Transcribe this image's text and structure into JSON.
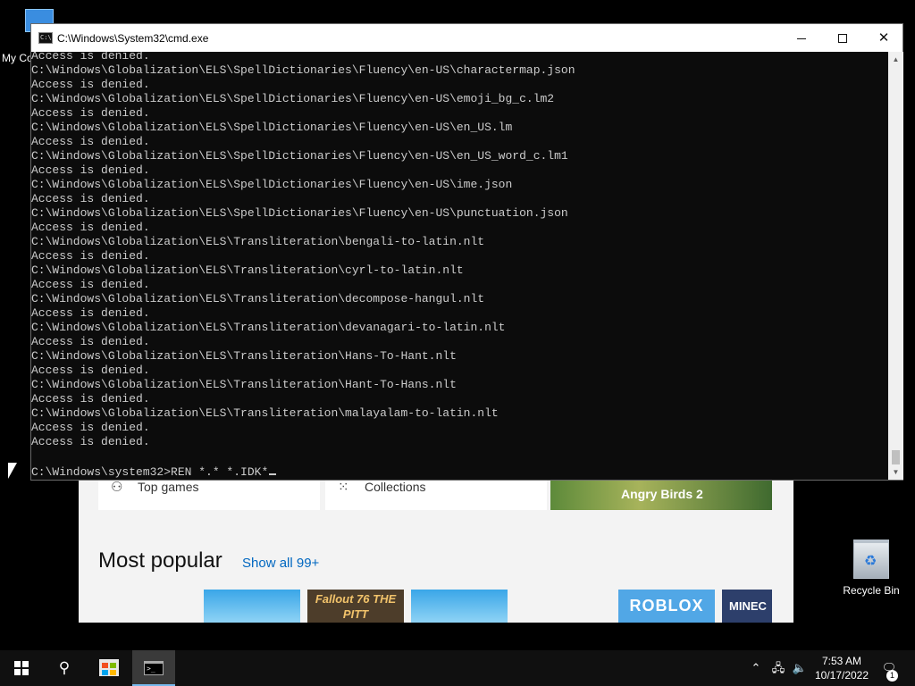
{
  "desktop": {
    "my_computer_label": "My Co",
    "recycle_bin_label": "Recycle Bin"
  },
  "store": {
    "cards": [
      "Top games",
      "Collections"
    ],
    "featured": "Angry Birds 2",
    "section_title": "Most popular",
    "show_all": "Show all 99+",
    "tiles": [
      "",
      "Fallout 76 THE PITT",
      "",
      "ROBLOX",
      "MINEC"
    ]
  },
  "cmd": {
    "title": "C:\\Windows\\System32\\cmd.exe",
    "icon_text": "C:\\",
    "lines": [
      "Access is denied.",
      "C:\\Windows\\Globalization\\ELS\\SpellDictionaries\\Fluency\\en-US\\charactermap.json",
      "Access is denied.",
      "C:\\Windows\\Globalization\\ELS\\SpellDictionaries\\Fluency\\en-US\\emoji_bg_c.lm2",
      "Access is denied.",
      "C:\\Windows\\Globalization\\ELS\\SpellDictionaries\\Fluency\\en-US\\en_US.lm",
      "Access is denied.",
      "C:\\Windows\\Globalization\\ELS\\SpellDictionaries\\Fluency\\en-US\\en_US_word_c.lm1",
      "Access is denied.",
      "C:\\Windows\\Globalization\\ELS\\SpellDictionaries\\Fluency\\en-US\\ime.json",
      "Access is denied.",
      "C:\\Windows\\Globalization\\ELS\\SpellDictionaries\\Fluency\\en-US\\punctuation.json",
      "Access is denied.",
      "C:\\Windows\\Globalization\\ELS\\Transliteration\\bengali-to-latin.nlt",
      "Access is denied.",
      "C:\\Windows\\Globalization\\ELS\\Transliteration\\cyrl-to-latin.nlt",
      "Access is denied.",
      "C:\\Windows\\Globalization\\ELS\\Transliteration\\decompose-hangul.nlt",
      "Access is denied.",
      "C:\\Windows\\Globalization\\ELS\\Transliteration\\devanagari-to-latin.nlt",
      "Access is denied.",
      "C:\\Windows\\Globalization\\ELS\\Transliteration\\Hans-To-Hant.nlt",
      "Access is denied.",
      "C:\\Windows\\Globalization\\ELS\\Transliteration\\Hant-To-Hans.nlt",
      "Access is denied.",
      "C:\\Windows\\Globalization\\ELS\\Transliteration\\malayalam-to-latin.nlt",
      "Access is denied.",
      "Access is denied."
    ],
    "prompt": "C:\\Windows\\system32>REN *.* *.IDK*"
  },
  "taskbar": {
    "icons": [
      "windows-logo-icon",
      "search-icon",
      "store-icon",
      "cmd-icon"
    ],
    "time": "7:53 AM",
    "date": "10/17/2022",
    "notification_count": "1"
  }
}
